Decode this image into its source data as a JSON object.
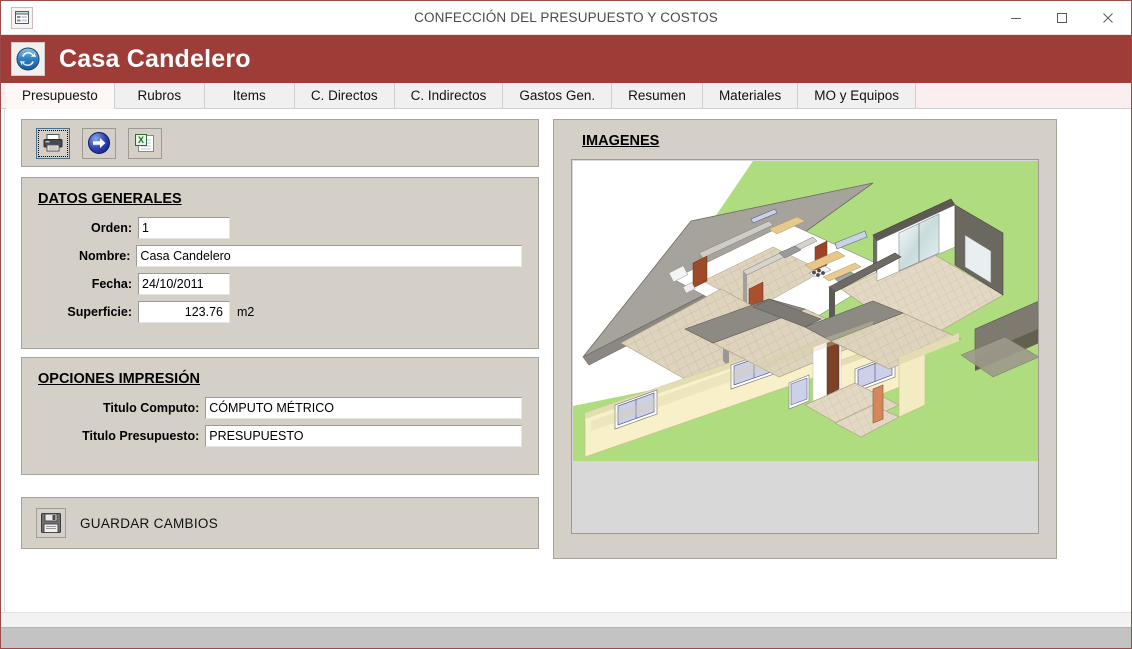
{
  "window": {
    "title": "CONFECCIÓN DEL PRESUPUESTO Y COSTOS",
    "icon": "form-icon",
    "controls": {
      "minimize": "minimize-icon",
      "maximize": "maximize-icon",
      "close": "close-icon"
    }
  },
  "header": {
    "title": "Casa Candelero",
    "logo": "refresh-circle-icon",
    "background_color": "#9e3c37"
  },
  "tabs": [
    {
      "label": "Presupuesto",
      "active": true
    },
    {
      "label": "Rubros",
      "active": false
    },
    {
      "label": "Items",
      "active": false
    },
    {
      "label": "C. Directos",
      "active": false
    },
    {
      "label": "C. Indirectos",
      "active": false
    },
    {
      "label": "Gastos Gen.",
      "active": false
    },
    {
      "label": "Resumen",
      "active": false
    },
    {
      "label": "Materiales",
      "active": false
    },
    {
      "label": "MO y Equipos",
      "active": false
    }
  ],
  "toolbar": {
    "buttons": [
      {
        "name": "print-button",
        "icon": "printer-icon",
        "focused": true
      },
      {
        "name": "next-button",
        "icon": "blue-arrow-right-icon",
        "focused": false
      },
      {
        "name": "export-excel-button",
        "icon": "excel-export-icon",
        "focused": false
      }
    ]
  },
  "datos_generales": {
    "title": "DATOS GENERALES",
    "fields": [
      {
        "label": "Orden:",
        "value": "1",
        "suffix": ""
      },
      {
        "label": "Nombre:",
        "value": "Casa Candelero",
        "suffix": ""
      },
      {
        "label": "Fecha:",
        "value": "24/10/2011",
        "suffix": ""
      },
      {
        "label": "Superficie:",
        "value": "123.76",
        "suffix": "m2"
      }
    ]
  },
  "opciones_impresion": {
    "title": "OPCIONES IMPRESIÓN",
    "fields": [
      {
        "label": "Titulo Computo:",
        "value": "CÓMPUTO MÉTRICO"
      },
      {
        "label": "Titulo Presupuesto:",
        "value": "PRESUPUESTO"
      }
    ]
  },
  "guardar": {
    "label": "GUARDAR CAMBIOS",
    "icon": "floppy-disk-icon"
  },
  "imagenes": {
    "title": "IMAGENES",
    "image_description": "3D architectural cutaway rendering of a single-family house floor plan on a green lawn"
  },
  "colors": {
    "panel": "#d4d0c8",
    "header_red": "#9e3c37",
    "tab_active": "#fdf7f6",
    "tab_inactive": "#f0f0f0",
    "lawn_green": "#aedc7f",
    "wall_cream": "#f7f0c8",
    "roof_tile": "#ded3bc"
  }
}
